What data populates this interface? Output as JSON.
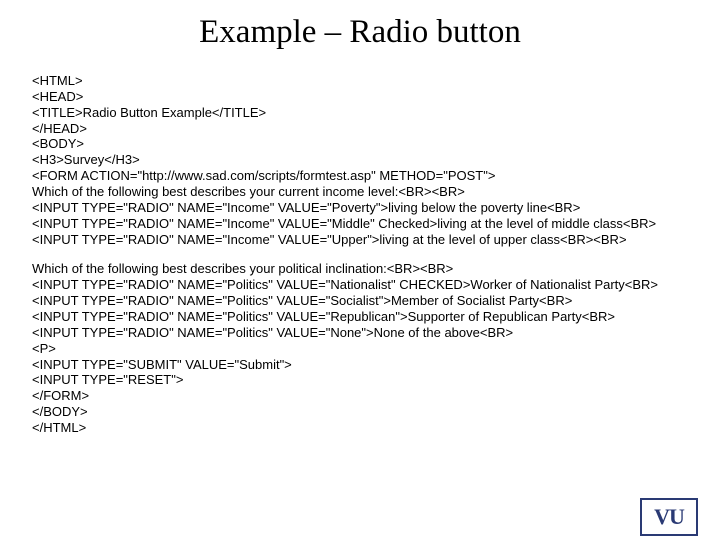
{
  "title": "Example – Radio button",
  "code": {
    "l1": "<HTML>",
    "l2": "<HEAD>",
    "l3": "<TITLE>Radio Button Example</TITLE>",
    "l4": "</HEAD>",
    "l5": "<BODY>",
    "l6": "<H3>Survey</H3>",
    "l7": "<FORM ACTION=\"http://www.sad.com/scripts/formtest.asp\" METHOD=\"POST\">",
    "l8": "Which of the following best describes your current income level:<BR><BR>",
    "l9": "<INPUT TYPE=\"RADIO\" NAME=\"Income\" VALUE=\"Poverty\">living below the poverty line<BR>",
    "l10": "<INPUT TYPE=\"RADIO\" NAME=\"Income\" VALUE=\"Middle\" Checked>living at the level of middle class<BR>",
    "l11": "<INPUT TYPE=\"RADIO\" NAME=\"Income\" VALUE=\"Upper\">living at the level of upper class<BR><BR>",
    "l12": "Which of the following best describes your political inclination:<BR><BR>",
    "l13": "<INPUT TYPE=\"RADIO\" NAME=\"Politics\" VALUE=\"Nationalist\" CHECKED>Worker of Nationalist Party<BR>",
    "l14": "<INPUT TYPE=\"RADIO\" NAME=\"Politics\" VALUE=\"Socialist\">Member of Socialist Party<BR>",
    "l15": "<INPUT TYPE=\"RADIO\" NAME=\"Politics\" VALUE=\"Republican\">Supporter of Republican Party<BR>",
    "l16": "<INPUT TYPE=\"RADIO\" NAME=\"Politics\" VALUE=\"None\">None of the above<BR>",
    "l17": "<P>",
    "l18": "<INPUT TYPE=\"SUBMIT\" VALUE=\"Submit\">",
    "l19": "<INPUT TYPE=\"RESET\">",
    "l20": "</FORM>",
    "l21": "</BODY>",
    "l22": "</HTML>"
  },
  "logo": "VU"
}
